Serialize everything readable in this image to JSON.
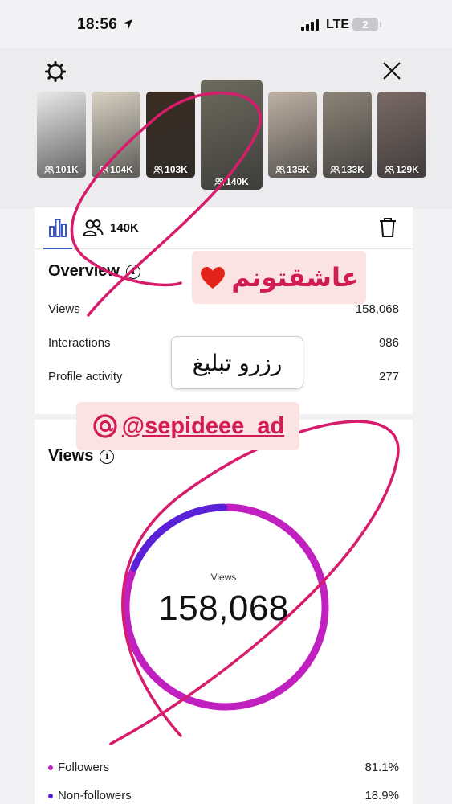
{
  "status_bar": {
    "time": "18:56",
    "network": "LTE",
    "battery": "2"
  },
  "stories": [
    {
      "count": "101K",
      "bg": "#e9e9ea",
      "selected": false
    },
    {
      "count": "104K",
      "bg": "#d9d2c4",
      "selected": false
    },
    {
      "count": "103K",
      "bg": "#3a2c22",
      "selected": false
    },
    {
      "count": "140K",
      "bg": "#6d6b5e",
      "selected": true
    },
    {
      "count": "135K",
      "bg": "#bfb2a5",
      "selected": false
    },
    {
      "count": "133K",
      "bg": "#8c8478",
      "selected": false
    },
    {
      "count": "129K",
      "bg": "#7a6a66",
      "selected": false
    }
  ],
  "tabs": {
    "audience_count": "140K"
  },
  "overview": {
    "title": "Overview",
    "rows": [
      {
        "label": "Views",
        "value": "158,068"
      },
      {
        "label": "Interactions",
        "value": "986"
      },
      {
        "label": "Profile activity",
        "value": "277"
      }
    ]
  },
  "views": {
    "title": "Views",
    "center_label": "Views",
    "center_value": "158,068",
    "legend": [
      {
        "label": "Followers",
        "value": "81.1%",
        "color": "#c21fc0"
      },
      {
        "label": "Non-followers",
        "value": "18.9%",
        "color": "#5a21d8"
      }
    ]
  },
  "chart_data": {
    "type": "pie",
    "categories": [
      "Followers",
      "Non-followers"
    ],
    "values": [
      81.1,
      18.9
    ],
    "title": "Views",
    "colors": [
      "#c21fc0",
      "#5a21d8"
    ]
  },
  "stickers": {
    "love_text": "عاشقتونم",
    "booking_text": "رزرو تبلیغ",
    "handle": "@sepideee_ad",
    "accent": "#d21a55"
  }
}
